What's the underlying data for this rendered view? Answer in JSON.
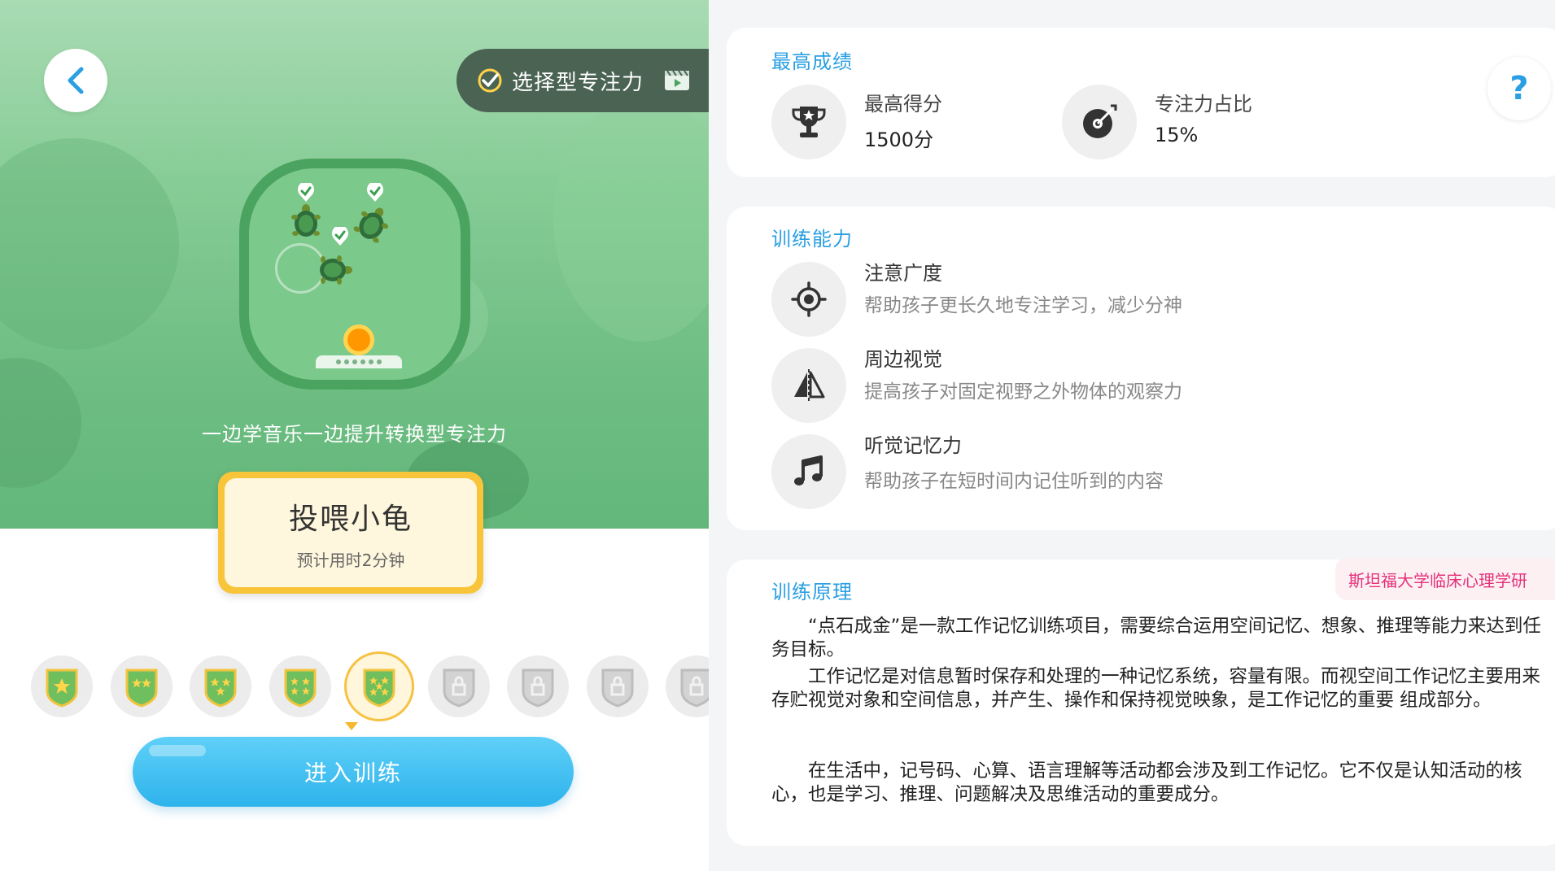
{
  "left": {
    "back_icon": "chevron-left-icon",
    "mode": {
      "label": "选择型专注力",
      "icon": "focus-check-icon",
      "video_icon": "video-icon"
    },
    "tagline": "一边学音乐一边提升转换型专注力",
    "game": {
      "name": "投喂小龟",
      "duration": "预计用时2分钟"
    },
    "levels": [
      {
        "state": "unlocked",
        "stars": 1
      },
      {
        "state": "unlocked",
        "stars": 2
      },
      {
        "state": "unlocked",
        "stars": 3
      },
      {
        "state": "unlocked",
        "stars": 4
      },
      {
        "state": "selected",
        "stars": 5
      },
      {
        "state": "locked"
      },
      {
        "state": "locked"
      },
      {
        "state": "locked"
      },
      {
        "state": "locked"
      }
    ],
    "enter_button": "进入训练"
  },
  "right": {
    "best": {
      "title": "最高成绩",
      "score_label": "最高得分",
      "score_value": "1500分",
      "focus_label": "专注力占比",
      "focus_value": "15%",
      "help": "?"
    },
    "ability": {
      "title": "训练能力",
      "items": [
        {
          "name": "注意广度",
          "desc": "帮助孩子更长久地专注学习，减少分神",
          "icon": "target-icon"
        },
        {
          "name": "周边视觉",
          "desc": "提高孩子对固定视野之外物体的观察力",
          "icon": "mirror-icon"
        },
        {
          "name": "听觉记忆力",
          "desc": "帮助孩子在短时间内记住听到的内容",
          "icon": "music-note-icon"
        }
      ]
    },
    "principle": {
      "title": "训练原理",
      "badge": "斯坦福大学临床心理学研",
      "p1": "“点石成金”是一款工作记忆训练项目，需要综合运用空间记忆、想象、推理等能力来达到任务目标。",
      "p2": "工作记忆是对信息暂时保存和处理的一种记忆系统，容量有限。而视空间工作记忆主要用来存贮视觉对象和空间信息，并产生、操作和保持视觉映象，是工作记忆的重要 组成部分。",
      "p3": "在生活中，记号码、心算、语言理解等活动都会涉及到工作记忆。它不仅是认知活动的核心，也是学习、推理、问题解决及思维活动的重要成分。"
    }
  },
  "colors": {
    "accent_blue": "#2a9fe3",
    "hero_green": "#6fbe84",
    "gold": "#f8c53a",
    "badge_pink": "#e4327a"
  }
}
